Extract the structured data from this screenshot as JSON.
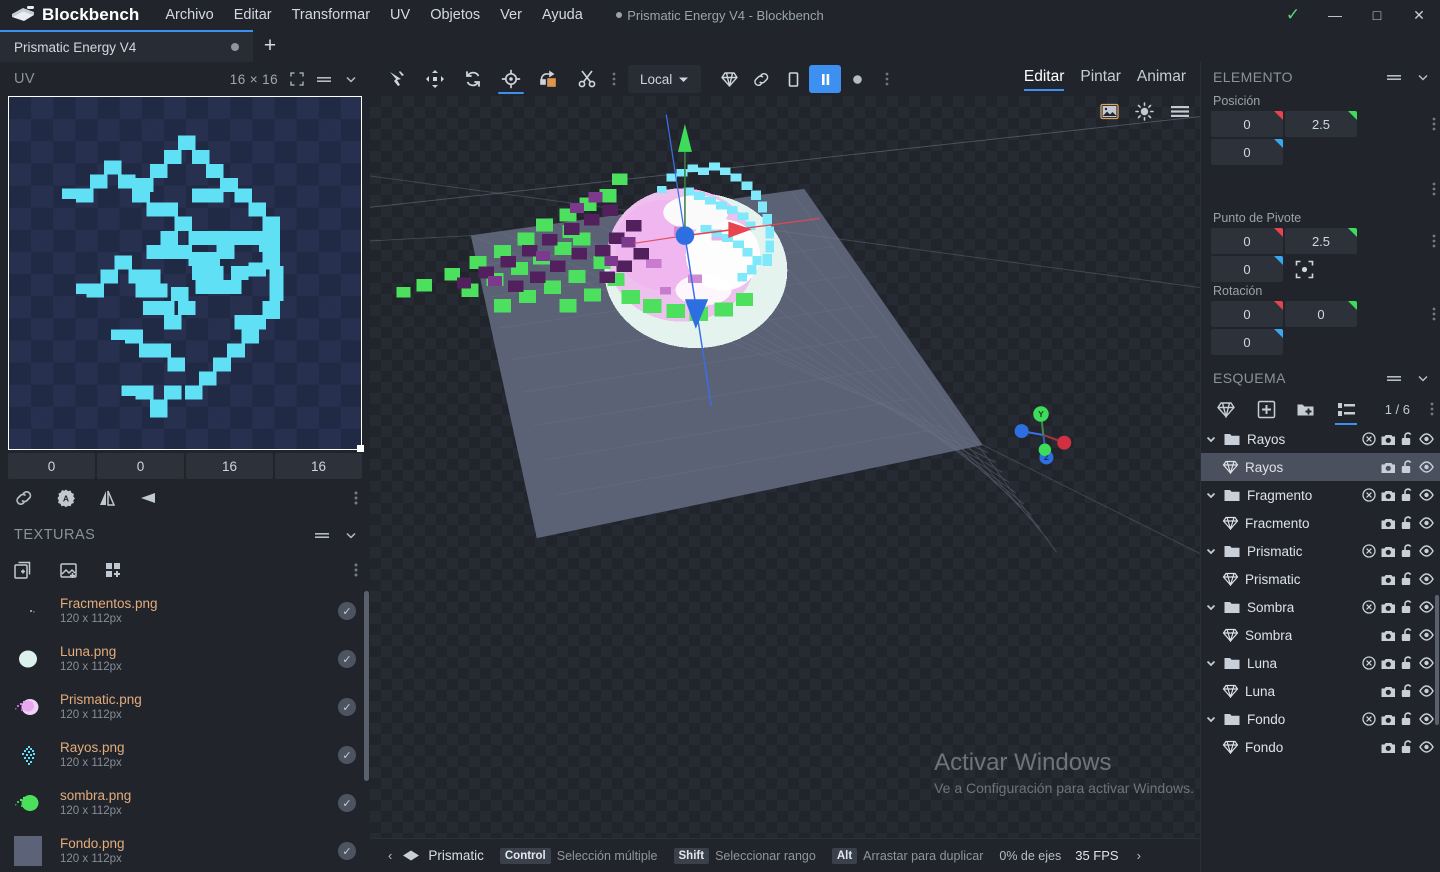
{
  "titlebar": {
    "app_name": "Blockbench",
    "logo_icon": "blockbench-logo-icon",
    "window_title": "Prismatic Energy V4 - Blockbench",
    "menus": [
      {
        "label": "Archivo",
        "name": "menu-archivo"
      },
      {
        "label": "Editar",
        "name": "menu-editar"
      },
      {
        "label": "Transformar",
        "name": "menu-transformar"
      },
      {
        "label": "UV",
        "name": "menu-uv"
      },
      {
        "label": "Objetos",
        "name": "menu-objetos"
      },
      {
        "label": "Ver",
        "name": "menu-ver"
      },
      {
        "label": "Ayuda",
        "name": "menu-ayuda"
      }
    ],
    "controls": {
      "check": "✓",
      "minimize": "—",
      "maximize": "□",
      "close": "✕"
    }
  },
  "tabbar": {
    "project_tab": "Prismatic Energy V4",
    "add_tab": "+"
  },
  "uv_panel": {
    "title": "UV",
    "size": "16 × 16",
    "fields": [
      "0",
      "0",
      "16",
      "16"
    ],
    "icons": [
      "fullscreen-icon",
      "menu-lines-icon",
      "chevron-down-icon"
    ],
    "tools": [
      "link-icon",
      "auto-uv-icon",
      "mirror-vertical-icon",
      "mirror-horizontal-icon",
      "overflow-dots-icon"
    ]
  },
  "textures_panel": {
    "title": "TEXTURAS",
    "toolbar": [
      "add-texture-icon",
      "import-texture-icon",
      "create-blank-texture-icon",
      "overflow-dots-icon"
    ],
    "items": [
      {
        "name": "Fracmentos.png",
        "resolution": "120 x 112px",
        "thumb": "fracmentos",
        "checked": true
      },
      {
        "name": "Luna.png",
        "resolution": "120 x 112px",
        "thumb": "luna",
        "checked": true
      },
      {
        "name": "Prismatic.png",
        "resolution": "120 x 112px",
        "thumb": "prismatic",
        "checked": true
      },
      {
        "name": "Rayos.png",
        "resolution": "120 x 112px",
        "thumb": "rayos",
        "checked": true
      },
      {
        "name": "sombra.png",
        "resolution": "120 x 112px",
        "thumb": "sombra",
        "checked": true
      },
      {
        "name": "Fondo.png",
        "resolution": "120 x 112px",
        "thumb": "fondo",
        "checked": true
      }
    ]
  },
  "toolbar": {
    "tools": [
      {
        "name": "move-tool",
        "icon": "cursor-move-icon",
        "active": false
      },
      {
        "name": "resize-tool",
        "icon": "arrows-four-icon",
        "active": false
      },
      {
        "name": "rotate-tool",
        "icon": "rotate-icon",
        "active": false
      },
      {
        "name": "pivot-tool",
        "icon": "pivot-target-icon",
        "active": true
      },
      {
        "name": "knife-tool",
        "icon": "vertex-snap-icon",
        "active": false
      },
      {
        "name": "cut-tool",
        "icon": "scissors-icon",
        "active": false
      }
    ],
    "space_select": "Local",
    "right_tools": [
      {
        "name": "gem-tool",
        "icon": "gem-icon",
        "active": false
      },
      {
        "name": "link-tool",
        "icon": "link-icon",
        "active": false
      },
      {
        "name": "rect-tool",
        "icon": "square-icon",
        "active": false
      },
      {
        "name": "pause-tool",
        "icon": "pause-icon",
        "active": true
      },
      {
        "name": "record-tool",
        "icon": "circle-icon",
        "active": false
      }
    ],
    "mode_tabs": [
      {
        "label": "Editar",
        "active": true
      },
      {
        "label": "Pintar",
        "active": false
      },
      {
        "label": "Animar",
        "active": false
      }
    ]
  },
  "viewport": {
    "top_icons": [
      "image-icon",
      "sun-icon",
      "menu-lines-icon"
    ],
    "gizmo_axes": [
      "X",
      "Y",
      "Z"
    ],
    "axis_colors": {
      "x": "#e8434e",
      "y": "#3ddc5a",
      "z": "#3a6ee8"
    }
  },
  "watermark": {
    "line1": "Activar Windows",
    "line2": "Ve a Configuración para activar Windows."
  },
  "statusbar": {
    "prev_arrow": "‹",
    "next_arrow": "›",
    "texture_name": "Prismatic",
    "hints": [
      {
        "key": "Control",
        "label": "Selección múltiple"
      },
      {
        "key": "Shift",
        "label": "Seleccionar rango"
      },
      {
        "key": "Alt",
        "label": "Arrastar para duplicar"
      }
    ],
    "axes": "0% de ejes",
    "fps": "35 FPS"
  },
  "element_panel": {
    "title": "ELEMENTO",
    "position_label": "Posición",
    "position": [
      "0",
      "2.5",
      "0"
    ],
    "pivot_label": "Punto de Pivote",
    "pivot": [
      "0",
      "2.5",
      "0"
    ],
    "rotation_label": "Rotación",
    "rotation": [
      "0",
      "0",
      "0"
    ]
  },
  "outliner_panel": {
    "title": "ESQUEMA",
    "count": "1 / 6",
    "toolbar": [
      "gem-icon",
      "add-cube-icon",
      "add-group-icon",
      "list-view-icon"
    ],
    "tree": [
      {
        "type": "group",
        "label": "Rayos",
        "icon": "folder-icon",
        "indent": 0,
        "selected": false,
        "controls": [
          "export-icon",
          "camera-icon",
          "unlock-icon",
          "eye-icon"
        ]
      },
      {
        "type": "element",
        "label": "Rayos",
        "icon": "gem-icon",
        "indent": 1,
        "selected": true,
        "controls": [
          "camera-icon",
          "unlock-icon",
          "eye-icon"
        ]
      },
      {
        "type": "group",
        "label": "Fragmento",
        "icon": "folder-icon",
        "indent": 0,
        "selected": false,
        "controls": [
          "export-icon",
          "camera-icon",
          "unlock-icon",
          "eye-icon"
        ]
      },
      {
        "type": "element",
        "label": "Fracmento",
        "icon": "gem-icon",
        "indent": 1,
        "selected": false,
        "controls": [
          "camera-icon",
          "unlock-icon",
          "eye-icon"
        ]
      },
      {
        "type": "group",
        "label": "Prismatic",
        "icon": "folder-icon",
        "indent": 0,
        "selected": false,
        "controls": [
          "export-icon",
          "camera-icon",
          "unlock-icon",
          "eye-icon"
        ]
      },
      {
        "type": "element",
        "label": "Prismatic",
        "icon": "gem-icon",
        "indent": 1,
        "selected": false,
        "controls": [
          "camera-icon",
          "unlock-icon",
          "eye-icon"
        ]
      },
      {
        "type": "group",
        "label": "Sombra",
        "icon": "folder-icon",
        "indent": 0,
        "selected": false,
        "controls": [
          "export-icon",
          "camera-icon",
          "unlock-icon",
          "eye-icon"
        ]
      },
      {
        "type": "element",
        "label": "Sombra",
        "icon": "gem-icon",
        "indent": 1,
        "selected": false,
        "controls": [
          "camera-icon",
          "unlock-icon",
          "eye-icon"
        ]
      },
      {
        "type": "group",
        "label": "Luna",
        "icon": "folder-icon",
        "indent": 0,
        "selected": false,
        "controls": [
          "export-icon",
          "camera-icon",
          "unlock-icon",
          "eye-icon"
        ]
      },
      {
        "type": "element",
        "label": "Luna",
        "icon": "gem-icon",
        "indent": 1,
        "selected": false,
        "controls": [
          "camera-icon",
          "unlock-icon",
          "eye-icon"
        ]
      },
      {
        "type": "group",
        "label": "Fondo",
        "icon": "folder-icon",
        "indent": 0,
        "selected": false,
        "controls": [
          "export-icon",
          "camera-icon",
          "unlock-icon",
          "eye-icon"
        ]
      },
      {
        "type": "element",
        "label": "Fondo",
        "icon": "gem-icon",
        "indent": 1,
        "selected": false,
        "controls": [
          "camera-icon",
          "unlock-icon",
          "eye-icon"
        ]
      }
    ]
  },
  "colors": {
    "accent": "#3e90f0",
    "background": "#21252b",
    "panel": "#282c34",
    "text": "#cbd2dd",
    "texture_name": "#e2ac7d",
    "selected_row": "#4a505e",
    "uv_bg": "#202a45",
    "uv_art": "#5fe0f5"
  }
}
